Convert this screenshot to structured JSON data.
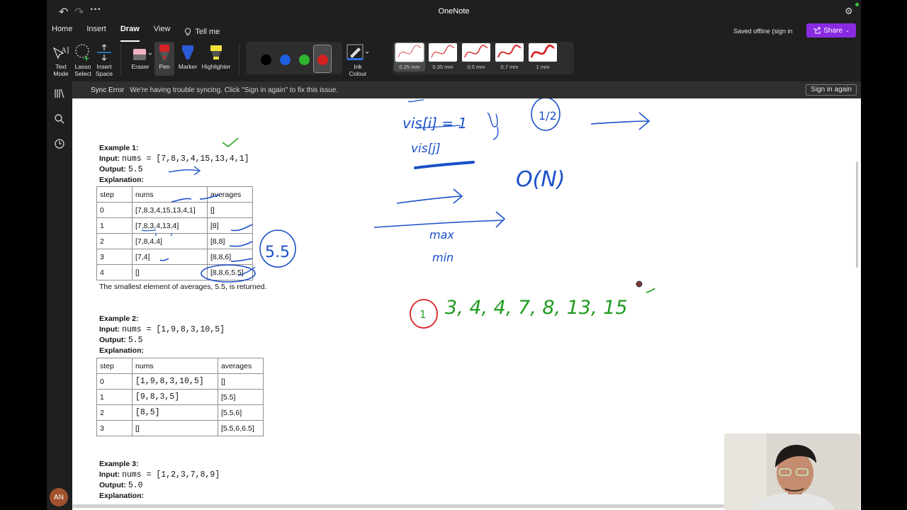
{
  "app": {
    "title": "OneNote"
  },
  "ribbon_tabs": [
    "Home",
    "Insert",
    "Draw",
    "View"
  ],
  "tell_me": "Tell me",
  "status": {
    "saved": "Saved offline (sign in"
  },
  "share_label": "Share",
  "tools": {
    "text_mode": [
      "Text",
      "Mode"
    ],
    "lasso": [
      "Lasso",
      "Select"
    ],
    "insert_space": [
      "Insert",
      "Space"
    ],
    "eraser": "Eraser",
    "pen": "Pen",
    "marker": "Marker",
    "highlighter": "Highlighter",
    "ink_colour": [
      "Ink",
      "Colour"
    ]
  },
  "colors": {
    "accent": "#8a2be2",
    "ink_black": "#000000",
    "ink_blue": "#1f5fe0",
    "ink_green": "#2fb52f",
    "ink_red": "#d61f1f",
    "handwriting_blue": "#1a50c8",
    "handwriting_green": "#1e9b1e"
  },
  "thickness": [
    "0.25 mm",
    "0.35 mm",
    "0.5 mm",
    "0.7 mm",
    "1 mm"
  ],
  "sync": {
    "title": "Sync Error",
    "message": "We're having trouble syncing. Click \"Sign in again\" to fix this issue.",
    "button": "Sign in again"
  },
  "user": {
    "initials": "AN"
  },
  "examples": [
    {
      "title": "Example 1:",
      "input_label": "Input:",
      "input": "nums = [7,8,3,4,15,13,4,1]",
      "output_label": "Output:",
      "output": "5.5",
      "explanation_label": "Explanation:",
      "headers": [
        "step",
        "nums",
        "averages"
      ],
      "rows": [
        [
          "0",
          "[7,8,3,4,15,13,4,1]",
          "[]"
        ],
        [
          "1",
          "[7,8,3,4,13,4]",
          "[8]"
        ],
        [
          "2",
          "[7,8,4,4]",
          "[8,8]"
        ],
        [
          "3",
          "[7,4]",
          "[8,8,6]"
        ],
        [
          "4",
          "[]",
          "[8,8,6,5.5]"
        ]
      ],
      "note": "The smallest element of averages, 5.5, is returned."
    },
    {
      "title": "Example 2:",
      "input_label": "Input:",
      "input": "nums = [1,9,8,3,10,5]",
      "output_label": "Output:",
      "output": "5.5",
      "explanation_label": "Explanation:",
      "headers": [
        "step",
        "nums",
        "averages"
      ],
      "rows": [
        [
          "0",
          "[1,9,8,3,10,5]",
          "[]"
        ],
        [
          "1",
          "[9,8,3,5]",
          "[5.5]"
        ],
        [
          "2",
          "[8,5]",
          "[5.5,6]"
        ],
        [
          "3",
          "[]",
          "[5.5,6,6.5]"
        ]
      ]
    },
    {
      "title": "Example 3:",
      "input_label": "Input:",
      "input": "nums = [1,2,3,7,8,9]",
      "output_label": "Output:",
      "output": "5.0",
      "explanation_label": "Explanation:"
    }
  ],
  "handwriting": {
    "vis_a": "vis[i] = 1",
    "vis_b": "vis[j]",
    "half": "1/2",
    "big_o": "O(N)",
    "max": "max",
    "min": "min",
    "five_five": "5.5",
    "sorted": "3, 4, 4, 7, 8, 13, 15",
    "circled_one": "1"
  }
}
